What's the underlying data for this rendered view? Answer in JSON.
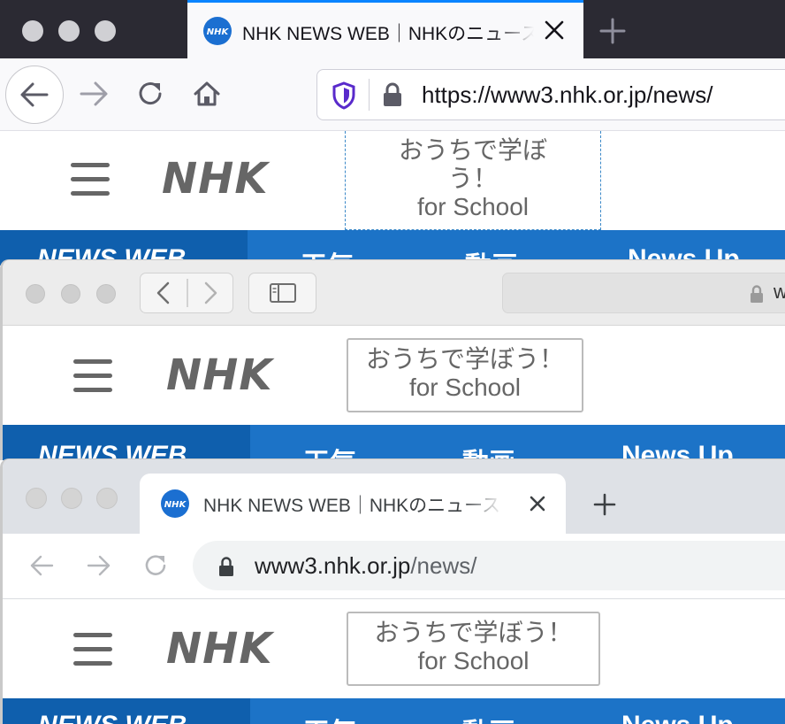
{
  "firefox": {
    "tab_title": "NHK NEWS WEB｜NHKのニュース",
    "url": "https://www3.nhk.or.jp/news/"
  },
  "safari": {
    "url_fragment": "w"
  },
  "chrome": {
    "tab_title": "NHK NEWS WEB｜NHKのニュース",
    "url_host": "www3.nhk.or.jp",
    "url_path": "/news/"
  },
  "page": {
    "logo": "NHK",
    "school_link_line1": "おうちで学ぼう！",
    "school_link_line2": "for School",
    "nav": {
      "brand": "NEWS WEB",
      "weather": "天気",
      "video": "動画",
      "news_up": "News Up"
    }
  },
  "colors": {
    "firefox_accent": "#0a84ff",
    "nhk_nav_blue": "#1c73c7",
    "nhk_brand_blue": "#0f5fad",
    "favicon_blue": "#1b6fd1",
    "private_shield": "#592acb"
  },
  "icons": {
    "back": "arrow-left-icon",
    "forward": "arrow-right-icon",
    "reload": "reload-icon",
    "home": "home-icon",
    "lock": "lock-icon",
    "tracking_protection": "shield-icon",
    "sidebar": "sidebar-icon",
    "close_tab": "close-icon",
    "new_tab": "plus-icon",
    "menu": "hamburger-icon",
    "favicon": "nhk-favicon-icon"
  }
}
